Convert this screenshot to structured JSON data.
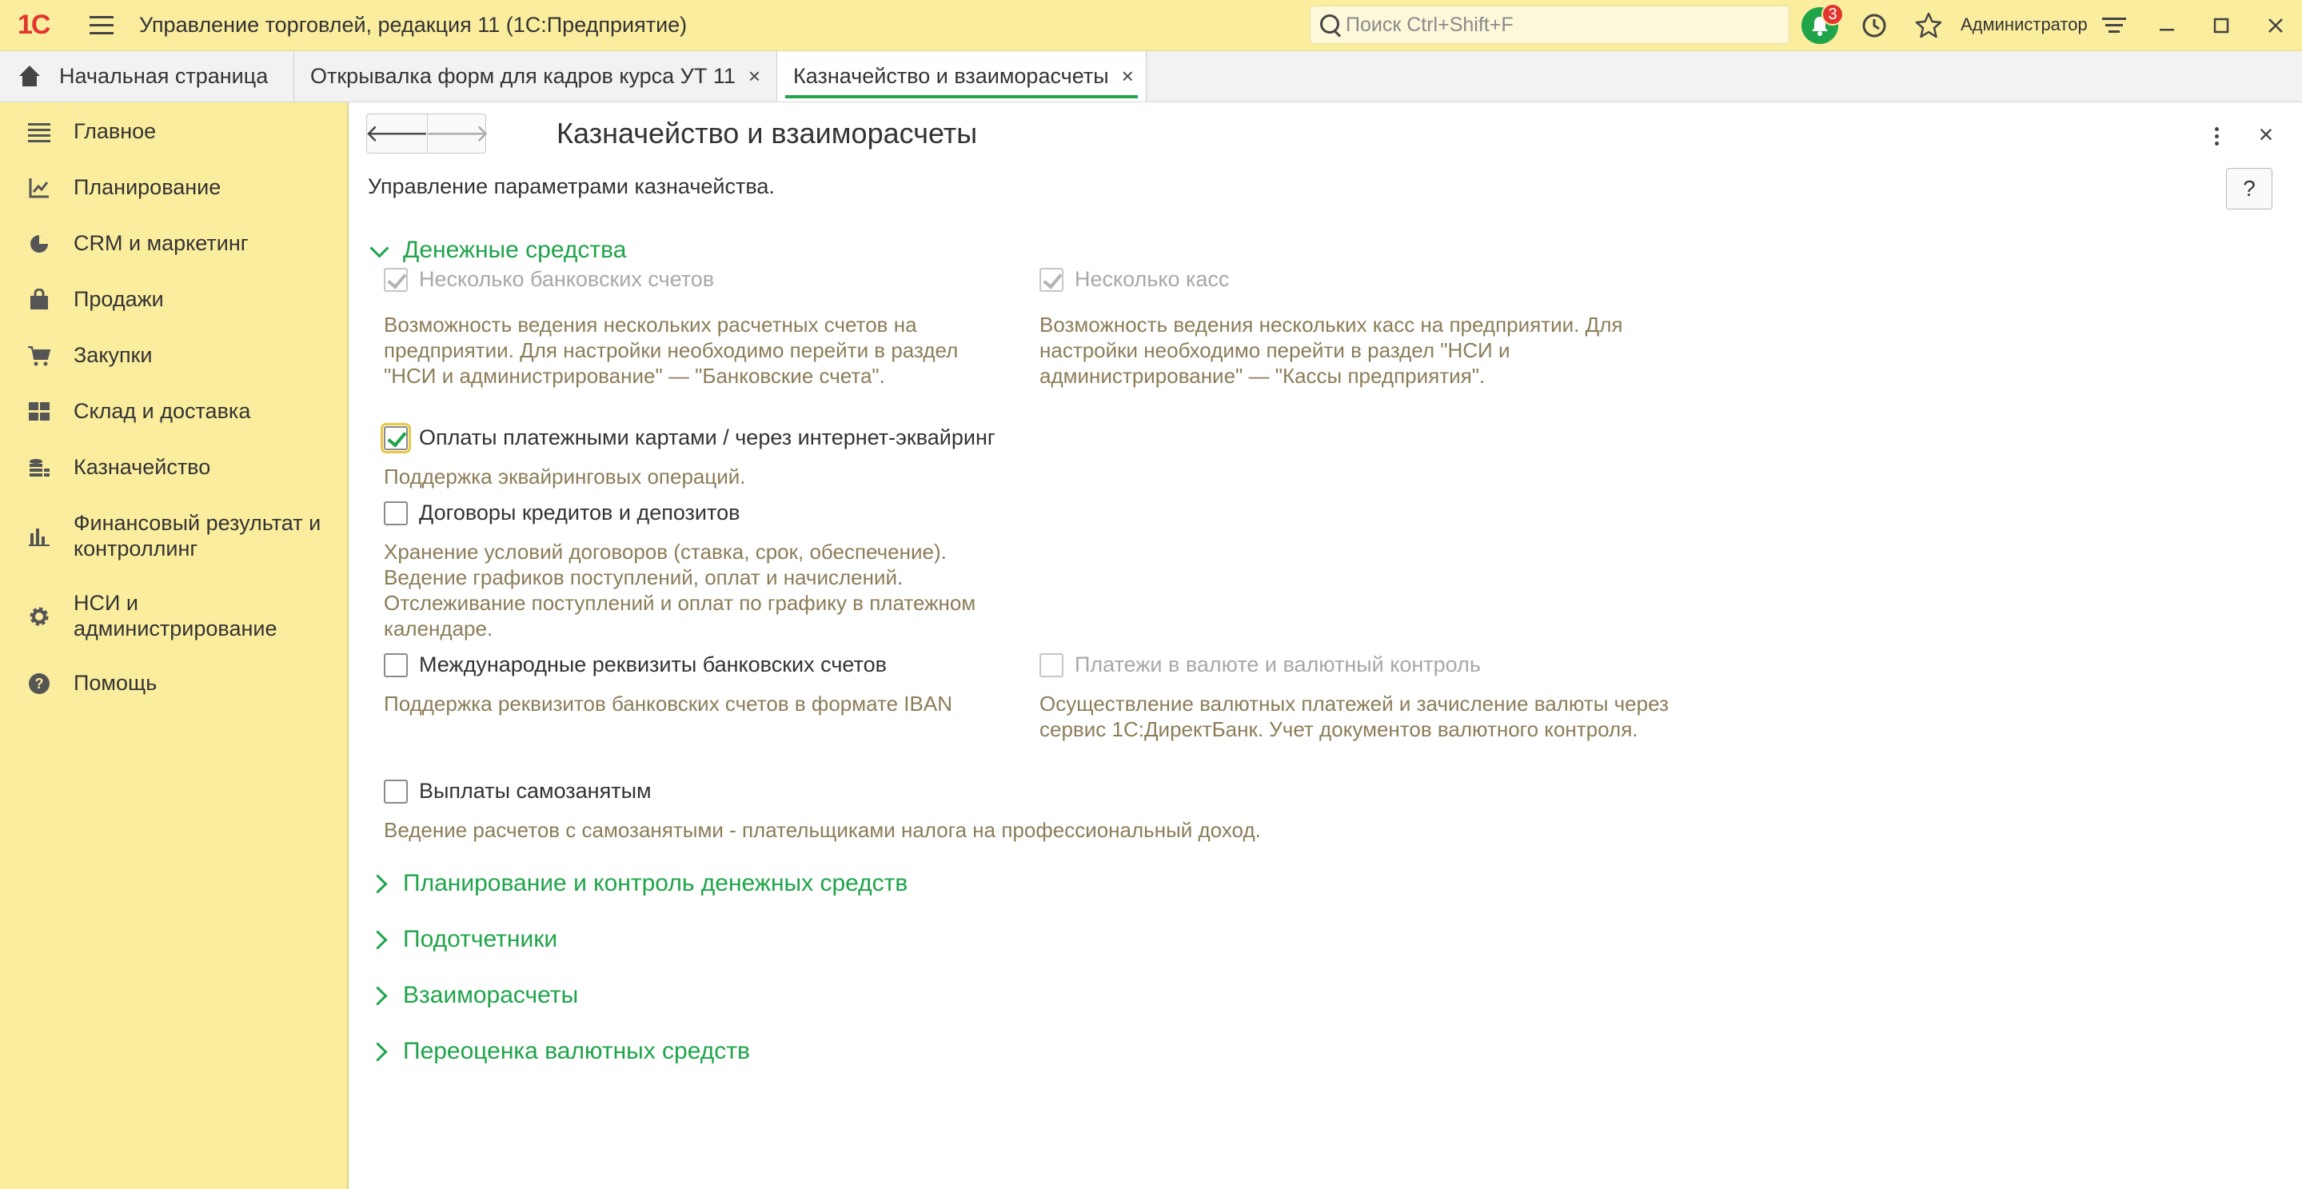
{
  "titlebar": {
    "logo": "1C",
    "app_title": "Управление торговлей, редакция 11  (1С:Предприятие)",
    "search_placeholder": "Поиск Ctrl+Shift+F",
    "notifications_count": "3",
    "user": "Администратор",
    "icons": [
      "menu-icon",
      "search-icon",
      "bell-icon",
      "history-icon",
      "star-icon",
      "settings-icon",
      "minimize-icon",
      "maximize-icon",
      "close-icon"
    ]
  },
  "tabs": [
    {
      "label": "Начальная страница",
      "icon": "home-icon"
    },
    {
      "label": "Открывалка форм для кадров курса УТ 11",
      "close": "×"
    },
    {
      "label": "Казначейство и взаиморасчеты",
      "close": "×",
      "active": true
    }
  ],
  "sidebar": {
    "items": [
      {
        "label": "Главное",
        "icon": "list-icon"
      },
      {
        "label": "Планирование",
        "icon": "chart-icon"
      },
      {
        "label": "CRM и маркетинг",
        "icon": "pie-icon"
      },
      {
        "label": "Продажи",
        "icon": "bag-icon"
      },
      {
        "label": "Закупки",
        "icon": "cart-icon"
      },
      {
        "label": "Склад и доставка",
        "icon": "warehouse-icon"
      },
      {
        "label": "Казначейство",
        "icon": "coins-icon"
      },
      {
        "label": "Финансовый результат и контроллинг",
        "icon": "bar-chart-icon"
      },
      {
        "label": "НСИ и администрирование",
        "icon": "gear-icon"
      },
      {
        "label": "Помощь",
        "icon": "question-icon"
      }
    ]
  },
  "form": {
    "back": "🡐",
    "forward": "🡒",
    "title": "Казначейство и взаиморасчеты",
    "help": "?",
    "close": "×",
    "subtitle": "Управление параметрами казначейства.",
    "group_cash": "Денежные средства",
    "opt_bank_accounts": "Несколько банковских счетов",
    "desc_bank_accounts": "Возможность ведения нескольких расчетных счетов на предприятии. Для настройки необходимо перейти в раздел \"НСИ и администрирование\" — \"Банковские счета\".",
    "opt_cashboxes": "Несколько касс",
    "desc_cashboxes": "Возможность ведения нескольких касс на предприятии. Для настройки необходимо перейти в раздел \"НСИ и администрирование\" — \"Кассы предприятия\".",
    "opt_acquiring": "Оплаты платежными картами / через интернет-эквайринг",
    "desc_acquiring": "Поддержка эквайринговых операций.",
    "opt_loans": "Договоры кредитов и депозитов",
    "desc_loans": "Хранение условий договоров (ставка, срок, обеспечение). Ведение графиков поступлений, оплат и начислений. Отслеживание поступлений и оплат по графику в платежном календаре.",
    "opt_iban": "Международные реквизиты банковских счетов",
    "desc_iban": "Поддержка реквизитов банковских счетов в формате IBAN",
    "opt_currency": "Платежи в валюте и валютный контроль",
    "desc_currency": "Осуществление валютных платежей и зачисление валюты через сервис 1С:ДиректБанк. Учет документов валютного контроля.",
    "opt_selfemployed": "Выплаты самозанятым",
    "desc_selfemployed": "Ведение расчетов с самозанятыми - плательщиками налога на профессиональный доход.",
    "group_planning": "Планирование и контроль денежных средств",
    "group_accountable": "Подотчетники",
    "group_settlements": "Взаиморасчеты",
    "group_revaluation": "Переоценка валютных средств"
  },
  "colors": {
    "accent_green": "#1fa44a",
    "panel_yellow": "#fbed9e",
    "description_text": "#8b7d58",
    "badge_red": "#e3342f"
  }
}
